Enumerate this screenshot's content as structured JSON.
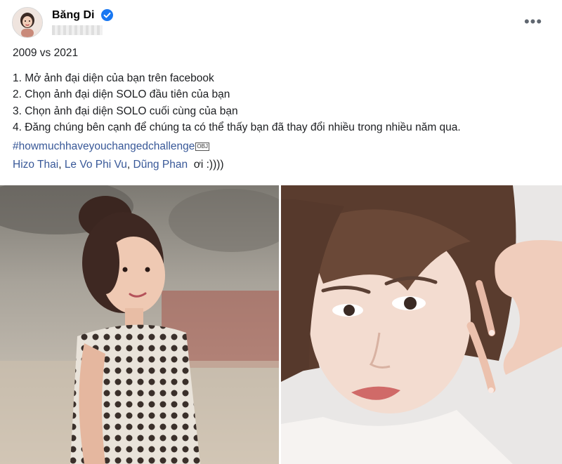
{
  "post": {
    "author": {
      "name": "Băng Di",
      "verified": true,
      "avatar_icon": "profile-photo"
    },
    "more_icon": "•••",
    "text": {
      "title_line": "2009 vs 2021",
      "steps": [
        "1. Mở ảnh đại diện của bạn trên facebook",
        "2. Chọn ảnh đại diện SOLO đầu tiên của bạn",
        "3. Chọn ảnh đại diện SOLO cuối cùng của bạn",
        "4. Đăng chúng bên cạnh để chúng ta có thể thấy bạn đã thay đổi nhiều trong nhiều năm qua."
      ],
      "hashtag": "#howmuchhaveyouchangedchallenge",
      "obj_glyph": "OBJ",
      "mentions": [
        "Hizo Thai",
        "Le Vo Phi Vu",
        "Dũng Phan"
      ],
      "mention_suffix": "ơi :))))"
    },
    "photos": [
      {
        "label": "2009 profile photo",
        "icon": "photo-2009"
      },
      {
        "label": "2021 profile photo",
        "icon": "photo-2021"
      }
    ],
    "colors": {
      "link": "#385898",
      "verified": "#1877f2",
      "text": "#1c1e21"
    }
  }
}
